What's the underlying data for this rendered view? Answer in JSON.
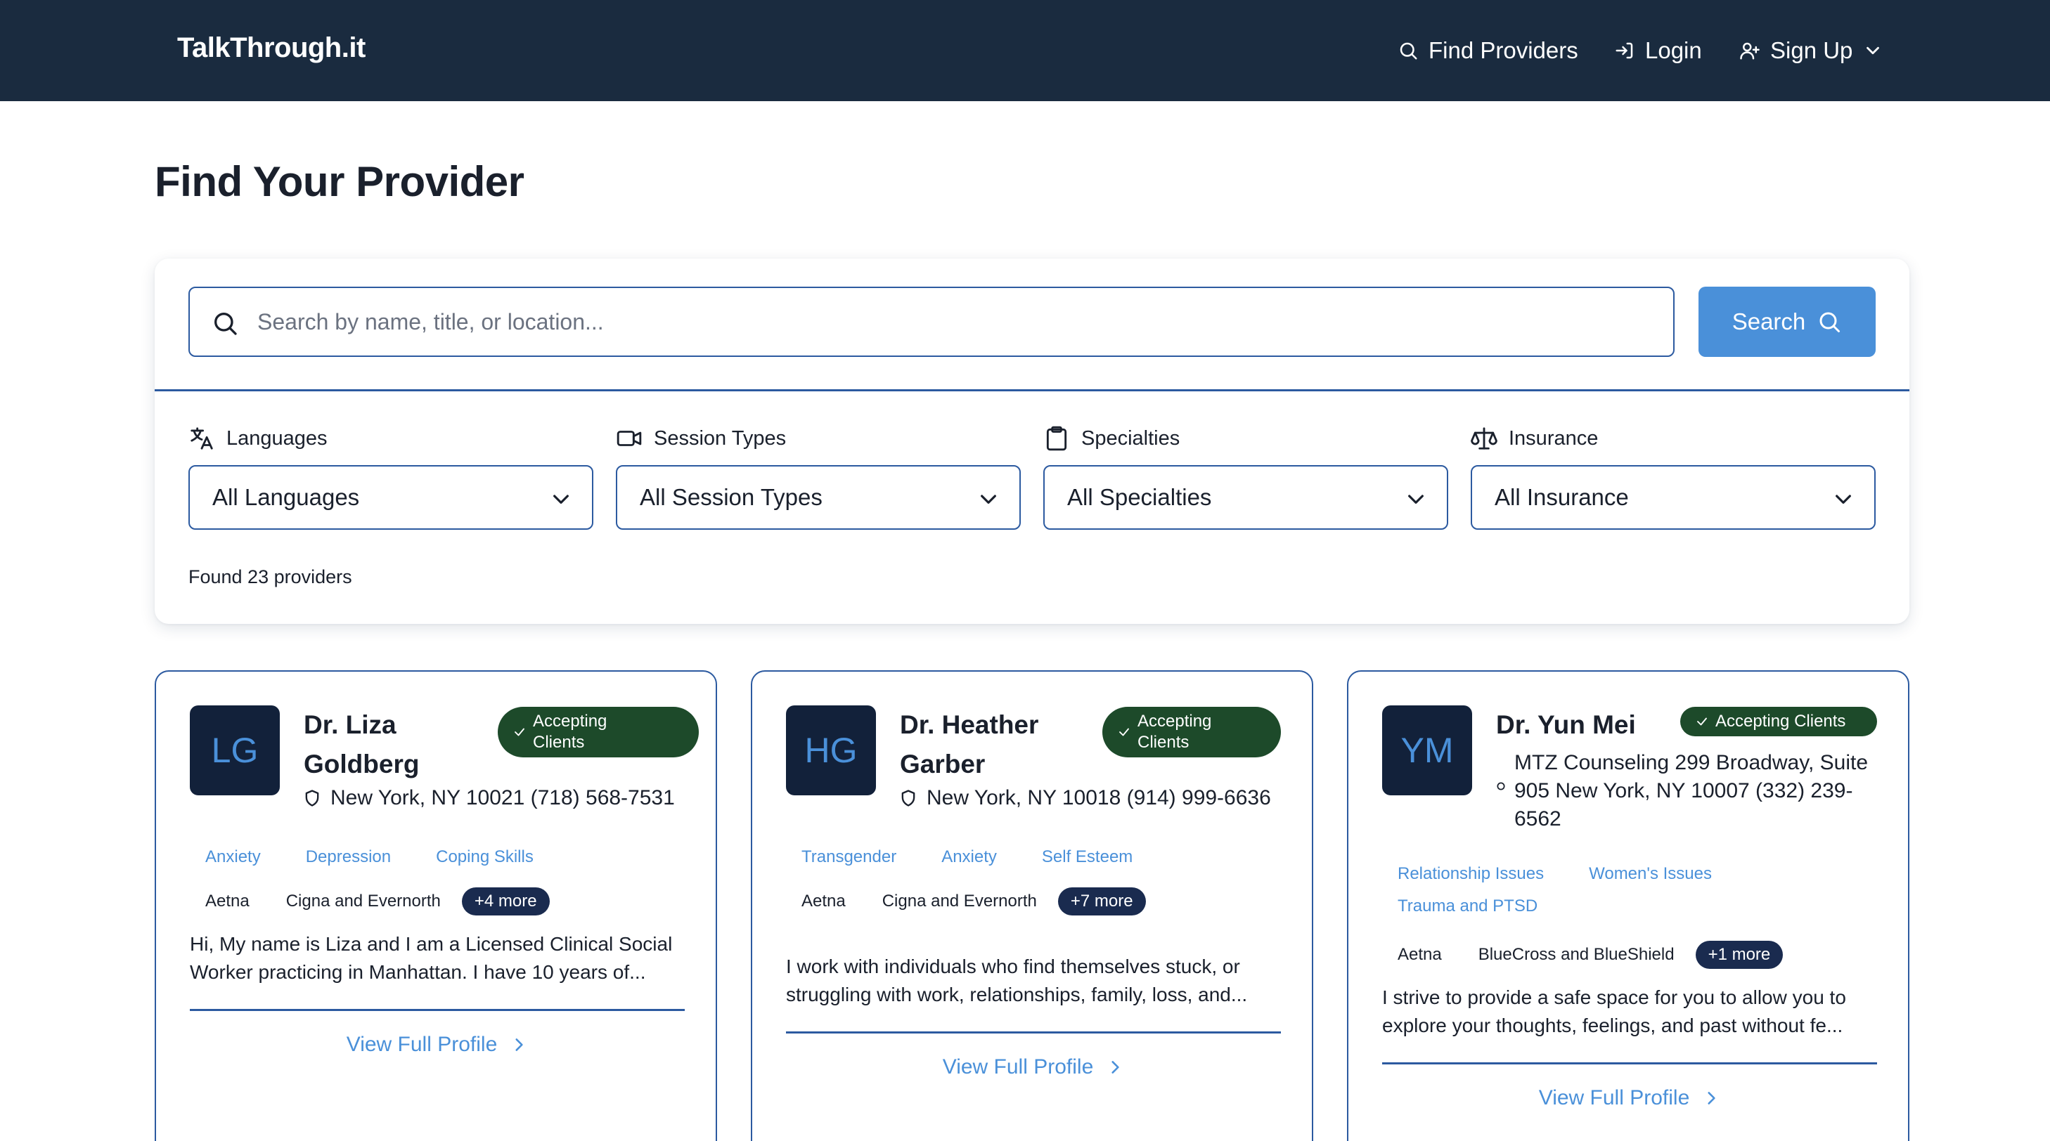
{
  "nav": {
    "brand": "TalkThrough.it",
    "find_providers": "Find Providers",
    "login": "Login",
    "sign_up": "Sign Up"
  },
  "page": {
    "title": "Find Your Provider"
  },
  "search": {
    "placeholder": "Search by name, title, or location...",
    "button_label": "Search"
  },
  "filters": [
    {
      "label": "Languages",
      "icon": "translate-icon",
      "value": "All Languages"
    },
    {
      "label": "Session Types",
      "icon": "video-icon",
      "value": "All Session Types"
    },
    {
      "label": "Specialties",
      "icon": "clipboard-icon",
      "value": "All Specialties"
    },
    {
      "label": "Insurance",
      "icon": "scale-icon",
      "value": "All Insurance"
    }
  ],
  "results": {
    "count_text": "Found 23 providers"
  },
  "colors": {
    "nav_bg": "#1a2b3f",
    "accent": "#4a90d9",
    "border": "#2c5aa0",
    "badge_bg": "#1d4a2a",
    "more_bg": "#1a2b4f"
  },
  "providers": [
    {
      "initials": "LG",
      "name_line1": "Dr. Liza",
      "name_line2": "Goldberg",
      "badge_line1": "Accepting",
      "badge_line2": "Clients",
      "location": "New York, NY 10021 (718) 568-7531",
      "specialties": [
        "Anxiety",
        "Depression",
        "Coping Skills"
      ],
      "insurance": [
        "Aetna",
        "Cigna and Evernorth"
      ],
      "more": "+4 more",
      "description_line1": "Hi, My name is Liza and I am a Licensed Clinical Social",
      "description_line2": "Worker practicing in Manhattan. I have 10 years of...",
      "link": "View Full Profile"
    },
    {
      "initials": "HG",
      "name_line1": "Dr. Heather",
      "name_line2": "Garber",
      "badge_line1": "Accepting",
      "badge_line2": "Clients",
      "location": "New York, NY 10018 (914) 999-6636",
      "specialties": [
        "Transgender",
        "Anxiety",
        "Self Esteem"
      ],
      "insurance": [
        "Aetna",
        "Cigna and Evernorth"
      ],
      "more": "+7 more",
      "description_line1": "I work with individuals who find themselves stuck, or",
      "description_line2": "struggling with work, relationships, family, loss, and...",
      "link": "View Full Profile"
    },
    {
      "initials": "YM",
      "name_line1": "Dr. Yun Mei",
      "badge": "Accepting Clients",
      "location_line1": "MTZ Counseling 299 Broadway, Suite",
      "location_line2": "905 New York, NY 10007 (332) 239-",
      "location_line3": "6562",
      "specialties": [
        "Relationship Issues",
        "Women's Issues",
        "Trauma and PTSD"
      ],
      "insurance": [
        "Aetna",
        "BlueCross and BlueShield"
      ],
      "more": "+1 more",
      "description_line1": "I strive to provide a safe space for you to allow you to",
      "description_line2": "explore your thoughts, feelings, and past without fe...",
      "link": "View Full Profile"
    }
  ]
}
